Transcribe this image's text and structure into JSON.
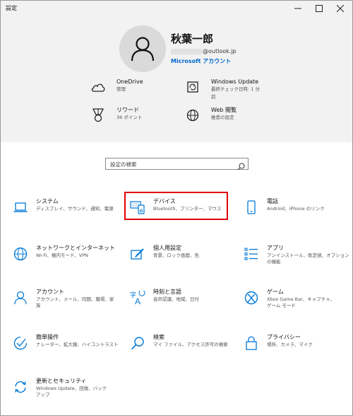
{
  "window": {
    "title": "設定"
  },
  "header": {
    "user_name": "秋葉一郎",
    "email_domain": "@outlook.jp",
    "account_link": "Microsoft アカウント",
    "items": [
      {
        "title": "OneDrive",
        "subtitle": "管理",
        "icon": "cloud-icon"
      },
      {
        "title": "Windows Update",
        "subtitle": "最終チェック日時: 1 分",
        "subtitle2": "前",
        "icon": "sync-icon"
      },
      {
        "title": "リワード",
        "subtitle": "36 ポイント",
        "icon": "medal-icon"
      },
      {
        "title": "Web 閲覧",
        "subtitle": "推奨の設定",
        "icon": "globe-icon"
      }
    ]
  },
  "search": {
    "placeholder": "設定の検索"
  },
  "tiles": [
    {
      "title": "システム",
      "sub1": "ディスプレイ、サウンド、通知、電源",
      "sub2": "",
      "icon": "laptop-icon"
    },
    {
      "title": "デバイス",
      "sub1": "Bluetooth、プリンター、マウス",
      "sub2": "",
      "icon": "devices-icon"
    },
    {
      "title": "電話",
      "sub1": "Android、iPhone のリンク",
      "sub2": "",
      "icon": "phone-icon"
    },
    {
      "title": "ネットワークとインターネット",
      "sub1": "Wi-Fi、機内モード、VPN",
      "sub2": "",
      "icon": "network-globe-icon"
    },
    {
      "title": "個人用設定",
      "sub1": "背景、ロック画面、色",
      "sub2": "",
      "icon": "personalization-icon"
    },
    {
      "title": "アプリ",
      "sub1": "アンインストール、既定値、オプション",
      "sub2": "の機能",
      "icon": "apps-icon"
    },
    {
      "title": "アカウント",
      "sub1": "アカウント、メール、同期、職場、家",
      "sub2": "族",
      "icon": "account-icon"
    },
    {
      "title": "時刻と言語",
      "sub1": "音声認識、地域、日付",
      "sub2": "",
      "icon": "time-language-icon"
    },
    {
      "title": "ゲーム",
      "sub1": "Xbox Game Bar、キャプチャ、",
      "sub2": "ゲーム モード",
      "icon": "xbox-icon"
    },
    {
      "title": "簡単操作",
      "sub1": "ナレーター、拡大鏡、ハイコントラスト",
      "sub2": "",
      "icon": "ease-of-access-icon"
    },
    {
      "title": "検索",
      "sub1": "マイ ファイル、アクセス許可の検索",
      "sub2": "",
      "icon": "search-icon"
    },
    {
      "title": "プライバシー",
      "sub1": "場所、カメラ、マイク",
      "sub2": "",
      "icon": "lock-icon"
    },
    {
      "title": "更新とセキュリティ",
      "sub1": "Windows Update、回復、バック",
      "sub2": "アップ",
      "icon": "update-icon"
    }
  ]
}
